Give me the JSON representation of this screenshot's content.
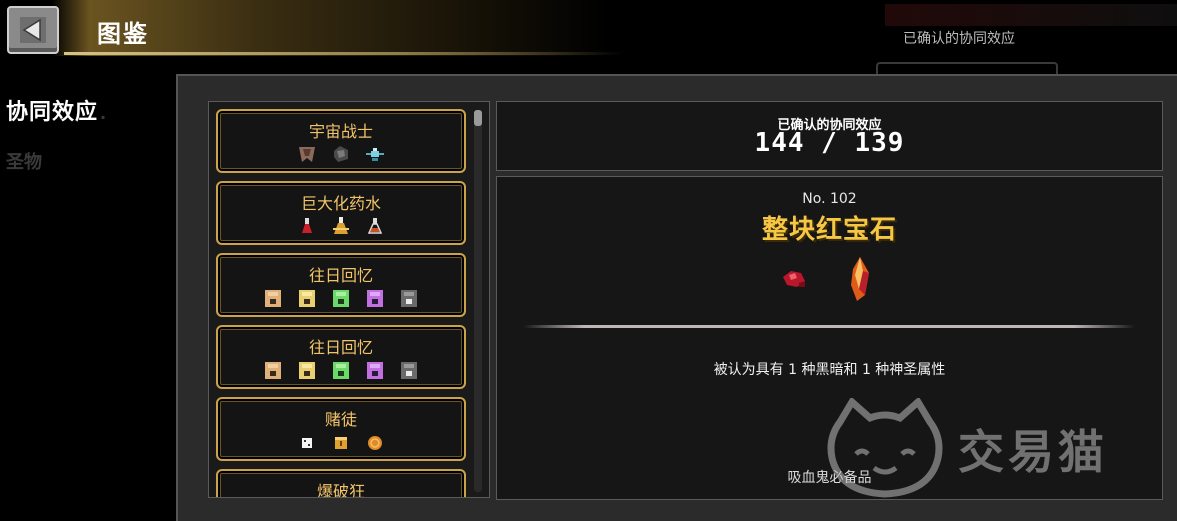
{
  "header": {
    "title": "图鉴"
  },
  "nav": {
    "synergy": "协同效应",
    "other": "圣物"
  },
  "background": {
    "right_title": "已确认的协同效应"
  },
  "count": {
    "label": "已确认的协同效应",
    "value": "144 / 139"
  },
  "synergies": [
    {
      "name": "宇宙战士",
      "icons": [
        "armor-icon",
        "helmet-icon",
        "drone-icon"
      ]
    },
    {
      "name": "巨大化药水",
      "icons": [
        "red-potion-icon",
        "gold-potion-icon",
        "flask-icon"
      ]
    },
    {
      "name": "往日回忆",
      "icons": [
        "memory-card-1-icon",
        "memory-card-2-icon",
        "memory-card-3-icon",
        "memory-card-4-icon",
        "memory-card-5-icon"
      ]
    },
    {
      "name": "往日回忆",
      "icons": [
        "memory-card-1-icon",
        "memory-card-2-icon",
        "memory-card-3-icon",
        "memory-card-4-icon",
        "memory-card-5-icon"
      ]
    },
    {
      "name": "赌徒",
      "icons": [
        "dice-icon",
        "box-icon",
        "coin-icon"
      ]
    },
    {
      "name": "爆破狂",
      "icons": []
    }
  ],
  "detail": {
    "number": "No. 102",
    "name": "整块红宝石",
    "icons": [
      "ruby-shard-icon",
      "ruby-crystal-icon"
    ],
    "description": "被认为具有 1 种黑暗和 1 种神圣属性",
    "footer": "吸血鬼必备品"
  },
  "watermark": {
    "text": "交易猫"
  },
  "colors": {
    "accent_gold": "#f6c744",
    "card_border": "#caa34a",
    "panel": "#161616"
  }
}
